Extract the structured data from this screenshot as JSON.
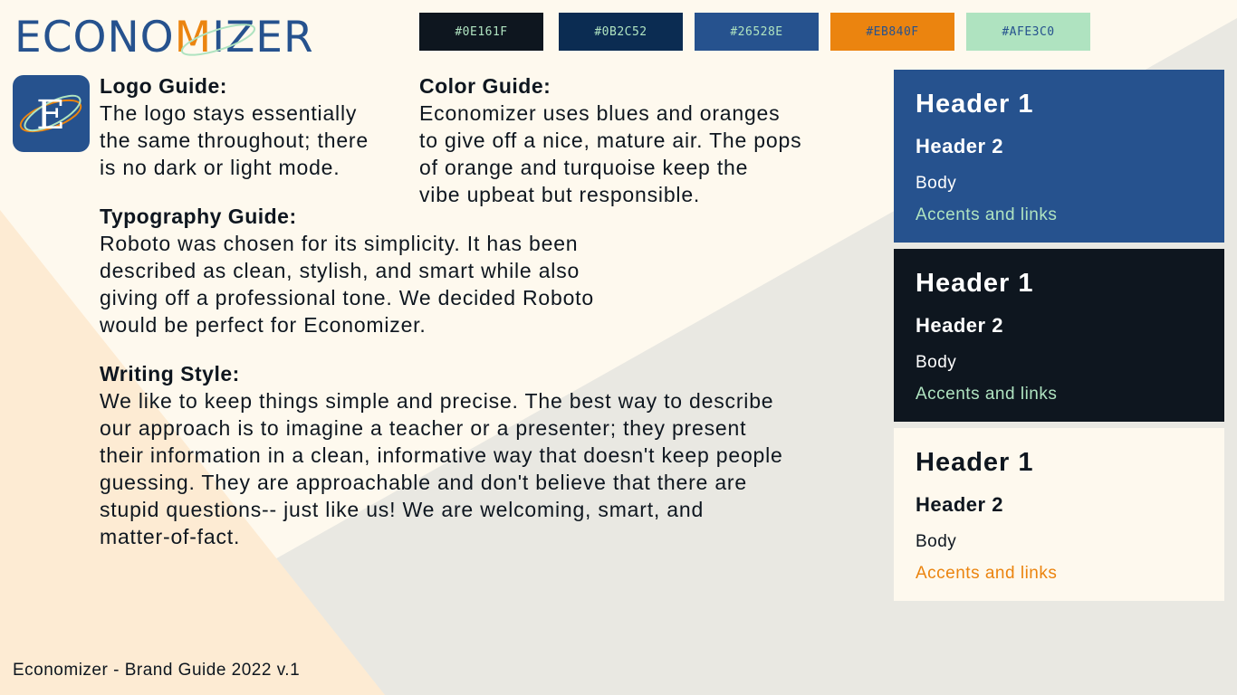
{
  "brand": {
    "wordmark_before": "ECONO",
    "wordmark_m": "M",
    "wordmark_after": "IZER",
    "logo_letter": "E"
  },
  "colors": {
    "swatches": [
      {
        "hex": "#0E161F",
        "label": "#0E161F",
        "text_color": "#AFE3C0"
      },
      {
        "hex": "#0B2C52",
        "label": "#0B2C52",
        "text_color": "#AFE3C0"
      },
      {
        "hex": "#26528E",
        "label": "#26528E",
        "text_color": "#AFE3C0"
      },
      {
        "hex": "#EB840F",
        "label": "#EB840F",
        "text_color": "#26528E"
      },
      {
        "hex": "#AFE3C0",
        "label": "#AFE3C0",
        "text_color": "#26528E"
      }
    ],
    "background": "#FEF9EE",
    "text": "#0E161F"
  },
  "logo_guide": {
    "title": "Logo Guide:",
    "body": "The logo stays essentially\nthe same throughout; there\nis no dark or light mode."
  },
  "color_guide": {
    "title": "Color Guide:",
    "body": "Economizer uses blues and oranges\nto give off a nice, mature air. The pops\nof orange and turquoise keep the\nvibe upbeat but responsible."
  },
  "typography_guide": {
    "title": "Typography Guide:",
    "body": "Roboto was chosen for its simplicity. It has been\ndescribed as clean, stylish, and smart while also\ngiving off a professional tone. We decided Roboto\nwould be perfect for Economizer."
  },
  "writing_style": {
    "title": "Writing Style:",
    "body": "We like to keep things simple and precise. The best way to describe\nour approach is to imagine a teacher or a presenter; they present\ntheir information in a clean, informative way that doesn't keep people\nguessing. They are approachable and don't believe that there are\nstupid questions-- just like us! We are welcoming, smart, and\nmatter-of-fact."
  },
  "type_cards": [
    {
      "bg": "#26528E",
      "text_color": "#FFFFFF",
      "accent_color": "#AFE3C0",
      "header1": "Header 1",
      "header2": "Header 2",
      "body": "Body",
      "accent": "Accents and links"
    },
    {
      "bg": "#0E161F",
      "text_color": "#FFFFFF",
      "accent_color": "#AFE3C0",
      "header1": "Header 1",
      "header2": "Header 2",
      "body": "Body",
      "accent": "Accents and links"
    },
    {
      "bg": "#FEF9EE",
      "text_color": "#0E161F",
      "accent_color": "#EB840F",
      "header1": "Header 1",
      "header2": "Header 2",
      "body": "Body",
      "accent": "Accents and links"
    }
  ],
  "footer": {
    "text": "Economizer - Brand Guide 2022 v.1"
  }
}
